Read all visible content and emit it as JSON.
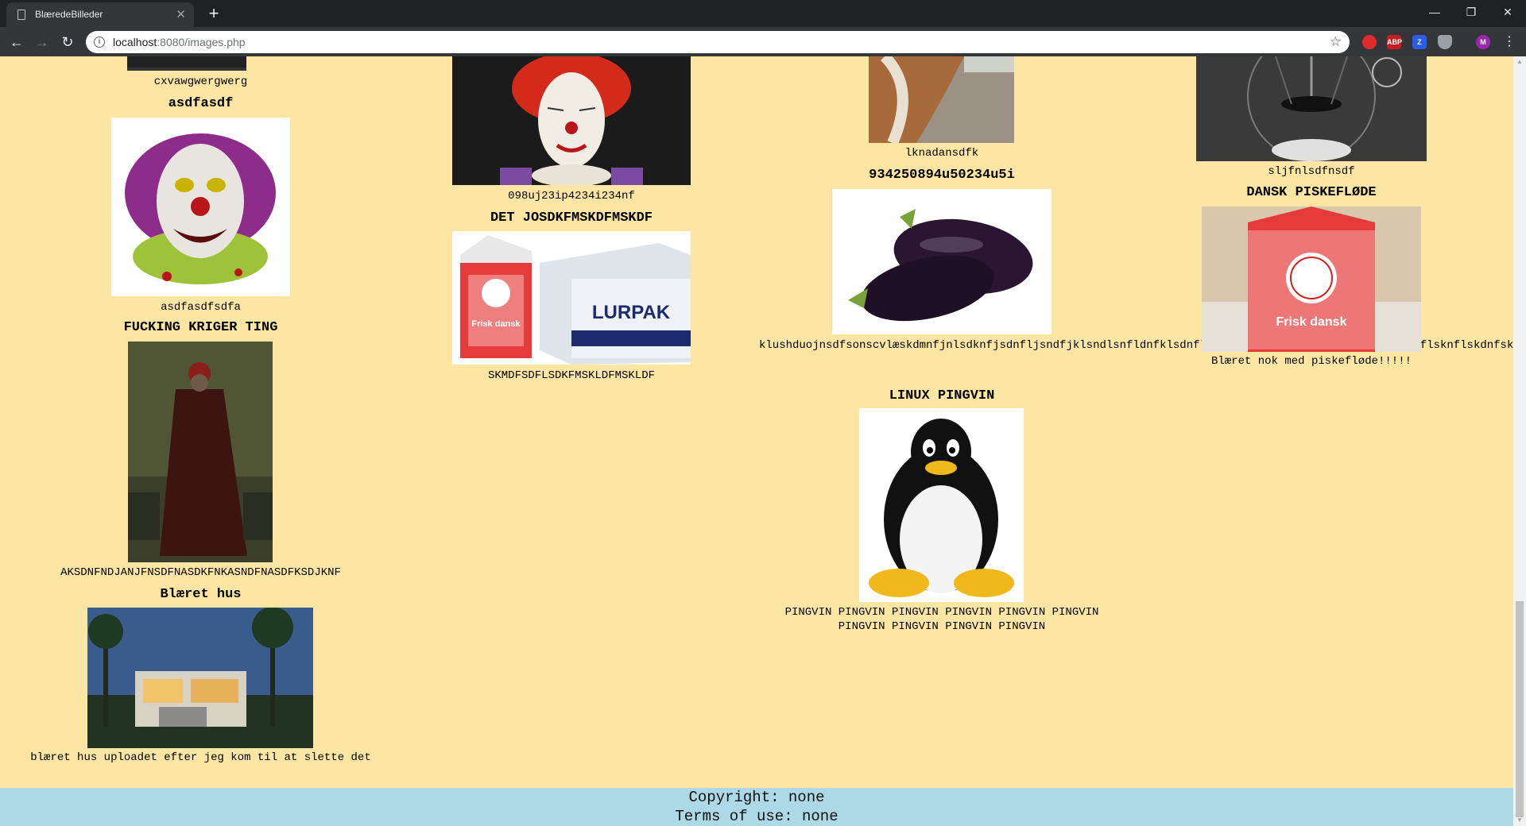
{
  "browser": {
    "tab_title": "BlæredeBilleder",
    "url_host": "localhost",
    "url_rest": ":8080/images.php",
    "ext_abp": "ABP",
    "ext_z": "Z",
    "profile": "M"
  },
  "images": [
    {
      "title": "",
      "desc": "cxvawgwergwerg",
      "icon": "dark-image-icon"
    },
    {
      "title": "asdfasdf",
      "desc": "asdfasdfsdfa",
      "icon": "evil-clown-icon"
    },
    {
      "title": "FUCKING KRIGER TING",
      "desc": "AKSDNFNDJANJFNSDFNASDKFNKASNDFNASDFKSDJKNF",
      "icon": "warrior-icon"
    },
    {
      "title": "Blæret hus",
      "desc": "blæret hus uploadet efter jeg kom til at slette det",
      "icon": "modern-house-icon"
    },
    {
      "title": "",
      "desc": "098uj23ip4234i234nf",
      "icon": "clown-icon"
    },
    {
      "title": "DET JOSDKFMSKDFMSKDF",
      "desc": "SKMDFSDFLSDKFMSKLDFMSKLDF",
      "icon": "butter-and-cream-icon"
    },
    {
      "title": "",
      "desc": "lknadansdfk",
      "icon": "animal-fur-icon"
    },
    {
      "title": "934250894u50234u5i",
      "desc": "klushduojnsdfsonscvlæskdmnfjnlsdknfjsdnfljsndfjklsndlsnfldnfklsdnflksdnflksdnfklsdnfsdknflsdknflsknflsknflskdnfskld",
      "icon": "eggplant-icon"
    },
    {
      "title": "LINUX PINGVIN",
      "desc": "PINGVIN PINGVIN PINGVIN PINGVIN PINGVIN PINGVIN PINGVIN PINGVIN PINGVIN PINGVIN",
      "icon": "penguin-icon"
    },
    {
      "title": "",
      "desc": "sljfnlsdfnsdf",
      "icon": "sci-fi-image-icon"
    },
    {
      "title": "DANSK PISKEFLØDE",
      "desc": "Blæret nok med piskefløde!!!!!",
      "icon": "cream-carton-icon"
    }
  ],
  "footer": {
    "copyright": "Copyright: none",
    "terms": "Terms of use: none"
  }
}
